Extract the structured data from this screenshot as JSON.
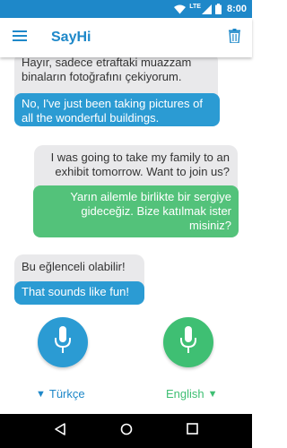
{
  "status_bar": {
    "time": "8:00",
    "network_label": "LTE",
    "icons": [
      "wifi-icon",
      "signal-icon",
      "battery-icon"
    ]
  },
  "app_bar": {
    "title": "SayHi",
    "menu_icon": "menu-icon",
    "delete_icon": "trash-icon"
  },
  "conversation": [
    {
      "side": "left",
      "original": "Hayır, sadece etraftaki muazzam binaların fotoğrafını çekiyorum.",
      "translation": "No, I've just been taking pictures of all the wonderful buildings."
    },
    {
      "side": "right",
      "original": "I was going to take my family to an exhibit tomorrow. Want to join us?",
      "translation": "Yarın ailemle birlikte bir sergiye gideceğiz. Bize katılmak ister misiniz?"
    },
    {
      "side": "left",
      "original": "Bu eğlenceli olabilir!",
      "translation": "That sounds like fun!"
    }
  ],
  "languages": {
    "left": "Türkçe",
    "right": "English",
    "left_prefix": "▼",
    "right_suffix": "▼"
  },
  "colors": {
    "primary_blue": "#1e88c9",
    "bubble_blue": "#2b9bd3",
    "bubble_green": "#53c27a",
    "bubble_grey": "#e9e9eb",
    "mic_blue": "#2b9bd3",
    "mic_green": "#3fbf73"
  },
  "nav_bar": {
    "icons": [
      "back-icon",
      "home-icon",
      "recents-icon"
    ]
  }
}
